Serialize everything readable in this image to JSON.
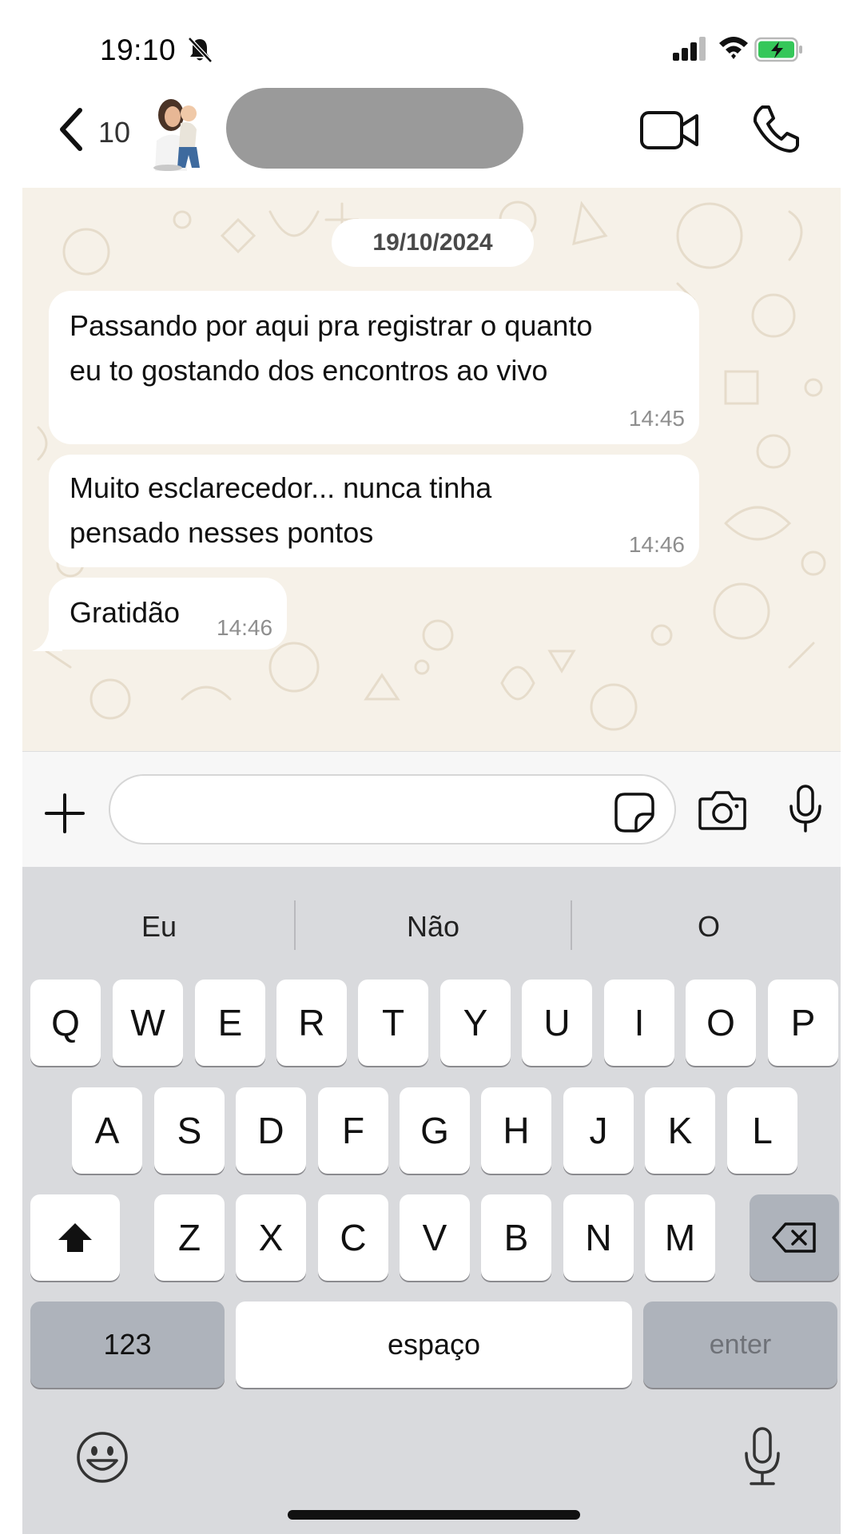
{
  "status_bar": {
    "time": "19:10",
    "icons": [
      "bell-muted-icon",
      "signal-icon",
      "wifi-icon",
      "battery-charging-icon"
    ],
    "battery_color": "#35c759"
  },
  "header": {
    "back_count": "10",
    "icons": [
      "chevron-left-icon",
      "avatar",
      "video-call-icon",
      "phone-call-icon"
    ]
  },
  "chat": {
    "background_color": "#f6f1e8",
    "date": "19/10/2024",
    "messages": [
      {
        "text": "Passando por aqui pra registrar o quanto\neu to gostando dos encontros ao vivo",
        "time": "14:45"
      },
      {
        "text": "Muito esclarecedor... nunca tinha\npensado nesses pontos",
        "time": "14:46"
      },
      {
        "text": "Gratidão",
        "time": "14:46"
      }
    ]
  },
  "input_bar": {
    "placeholder": "",
    "icons": [
      "plus-icon",
      "sticker-icon",
      "camera-icon",
      "microphone-icon"
    ]
  },
  "keyboard": {
    "suggestions": [
      "Eu",
      "Não",
      "O"
    ],
    "row1": [
      "Q",
      "W",
      "E",
      "R",
      "T",
      "Y",
      "U",
      "I",
      "O",
      "P"
    ],
    "row2": [
      "A",
      "S",
      "D",
      "F",
      "G",
      "H",
      "J",
      "K",
      "L"
    ],
    "row3": [
      "Z",
      "X",
      "C",
      "V",
      "B",
      "N",
      "M"
    ],
    "numbers_label": "123",
    "space_label": "espaço",
    "enter_label": "enter",
    "icons": [
      "shift-icon",
      "backspace-icon",
      "emoji-icon",
      "dictation-mic-icon"
    ]
  }
}
